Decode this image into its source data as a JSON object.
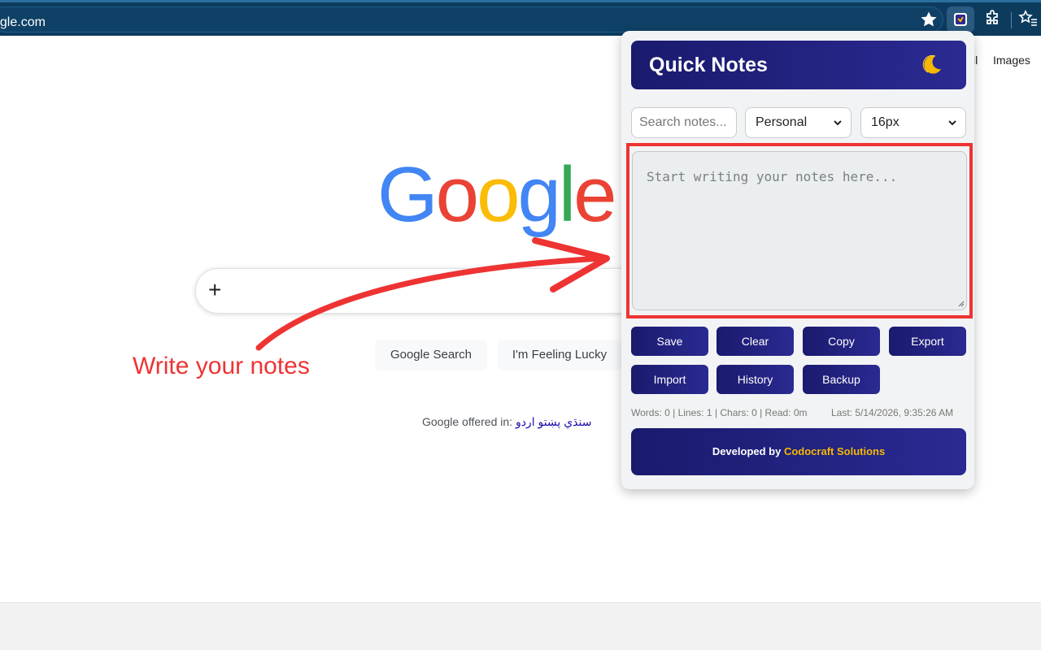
{
  "browser": {
    "url": "ogle.com"
  },
  "google": {
    "top_links": {
      "gmail_partial": "il",
      "images": "Images"
    },
    "logo": [
      "G",
      "o",
      "o",
      "g",
      "l",
      "e"
    ],
    "logo_colors": [
      "#4285f4",
      "#ea4335",
      "#fbbc05",
      "#4285f4",
      "#34a853",
      "#ea4335"
    ],
    "search_add": "+",
    "search_button": "Google Search",
    "lucky_button": "I'm Feeling Lucky",
    "offered_in_label": "Google offered in:",
    "offered_in_langs": "سنڌي پښتو اردو"
  },
  "annotation": {
    "text": "Write your notes",
    "color": "#ee3333"
  },
  "popup": {
    "title": "Quick Notes",
    "theme_icon": "moon-icon",
    "search_placeholder": "Search notes...",
    "category": "Personal",
    "font_size": "16px",
    "note_placeholder": "Start writing your notes here...",
    "buttons": {
      "save": "Save",
      "clear": "Clear",
      "copy": "Copy",
      "export": "Export",
      "import": "Import",
      "history": "History",
      "backup": "Backup"
    },
    "stats": "Words: 0 | Lines: 1 | Chars: 0 | Read: 0m",
    "last_saved": "Last: 5/14/2026, 9:35:26 AM",
    "footer_prefix": "Developed by",
    "footer_brand": "Codocraft Solutions",
    "accent_color": "#1a1a6e",
    "brand_color": "#f5b800"
  }
}
